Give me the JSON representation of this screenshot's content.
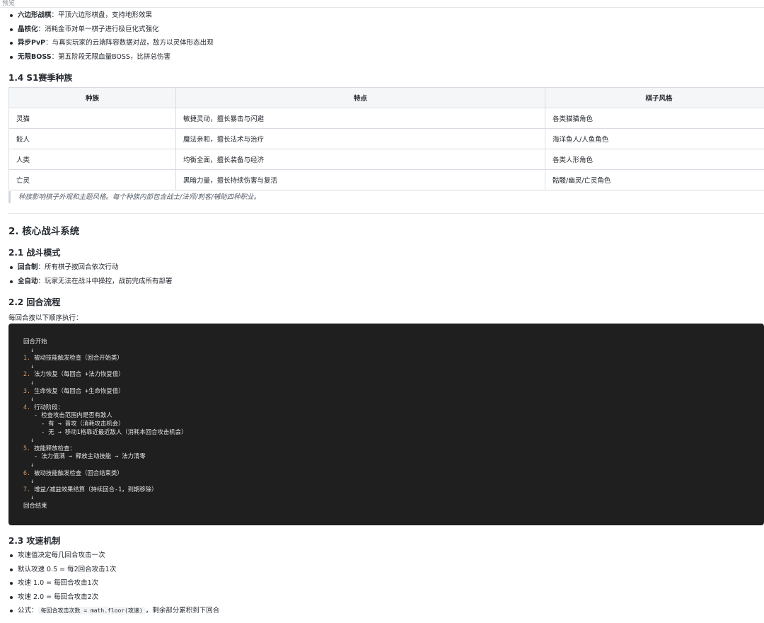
{
  "topbar": {
    "label": "预览"
  },
  "features": [
    {
      "bold": "六边形战棋",
      "text": "：平顶六边形棋盘，支持地形效果"
    },
    {
      "bold": "晶核化",
      "text": "：消耗金币对单一棋子进行极巨化式强化"
    },
    {
      "bold": "异步PvP",
      "text": "：与真实玩家的云端阵容数据对战，敌方以灵体形态出现"
    },
    {
      "bold": "无限BOSS",
      "text": "：第五阶段无限血量BOSS，比拼总伤害"
    }
  ],
  "section_1_4": {
    "title": "1.4 S1赛季种族",
    "headers": [
      "种族",
      "特点",
      "棋子风格"
    ],
    "rows": [
      [
        "灵猫",
        "敏捷灵动，擅长暴击与闪避",
        "各类猫猫角色"
      ],
      [
        "鲛人",
        "魔法亲和，擅长法术与治疗",
        "海洋鱼人/人鱼角色"
      ],
      [
        "人类",
        "均衡全面，擅长装备与经济",
        "各类人形角色"
      ],
      [
        "亡灵",
        "黑暗力量，擅长持续伤害与复活",
        "骷髅/幽灵/亡灵角色"
      ]
    ],
    "note": "种族影响棋子外观和主题风格。每个种族内部包含战士/法师/刺客/辅助四种职业。"
  },
  "section_2": {
    "title": "2. 核心战斗系统",
    "sub_2_1": {
      "title": "2.1 战斗模式",
      "items": [
        {
          "bold": "回合制",
          "text": "：所有棋子按回合依次行动"
        },
        {
          "bold": "全自动",
          "text": "：玩家无法在战斗中操控，战前完成所有部署"
        }
      ]
    },
    "sub_2_2": {
      "title": "2.2 回合流程",
      "intro": "每回合按以下顺序执行：",
      "code_lines": [
        {
          "num": "",
          "text": "回合开始"
        },
        {
          "num": "",
          "text": "  ↓"
        },
        {
          "num": "1.",
          "text": " 被动技能触发检查（回合开始类）"
        },
        {
          "num": "",
          "text": "  ↓"
        },
        {
          "num": "2.",
          "text": " 法力恢复（每回合 +法力恢复值）"
        },
        {
          "num": "",
          "text": "  ↓"
        },
        {
          "num": "3.",
          "text": " 生命恢复（每回合 +生命恢复值）"
        },
        {
          "num": "",
          "text": "  ↓"
        },
        {
          "num": "4.",
          "text": " 行动阶段："
        },
        {
          "num": "",
          "text": "   - 检查攻击范围内是否有敌人"
        },
        {
          "num": "",
          "text": "     - 有 → 普攻（消耗攻击机会）"
        },
        {
          "num": "",
          "text": "     - 无 → 移动1格靠近最近敌人（消耗本回合攻击机会）"
        },
        {
          "num": "",
          "text": "  ↓"
        },
        {
          "num": "5.",
          "text": " 技能释放检查："
        },
        {
          "num": "",
          "text": "   - 法力值满 → 释放主动技能 → 法力清零"
        },
        {
          "num": "",
          "text": "  ↓"
        },
        {
          "num": "6.",
          "text": " 被动技能触发检查（回合结束类）"
        },
        {
          "num": "",
          "text": "  ↓"
        },
        {
          "num": "7.",
          "text": " 增益/减益效果结算（持续回合-1，到期移除）"
        },
        {
          "num": "",
          "text": "  ↓"
        },
        {
          "num": "",
          "text": "回合结束"
        }
      ]
    },
    "sub_2_3": {
      "title": "2.3 攻速机制",
      "items": [
        "攻速值决定每几回合攻击一次",
        "默认攻速 0.5 = 每2回合攻击1次",
        "攻速 1.0 = 每回合攻击1次",
        "攻速 2.0 = 每回合攻击2次"
      ],
      "formula_prefix": "公式：",
      "formula_code": "每回合攻击次数 = math.floor(攻速)",
      "formula_suffix": "，剩余部分累积到下回合"
    }
  }
}
